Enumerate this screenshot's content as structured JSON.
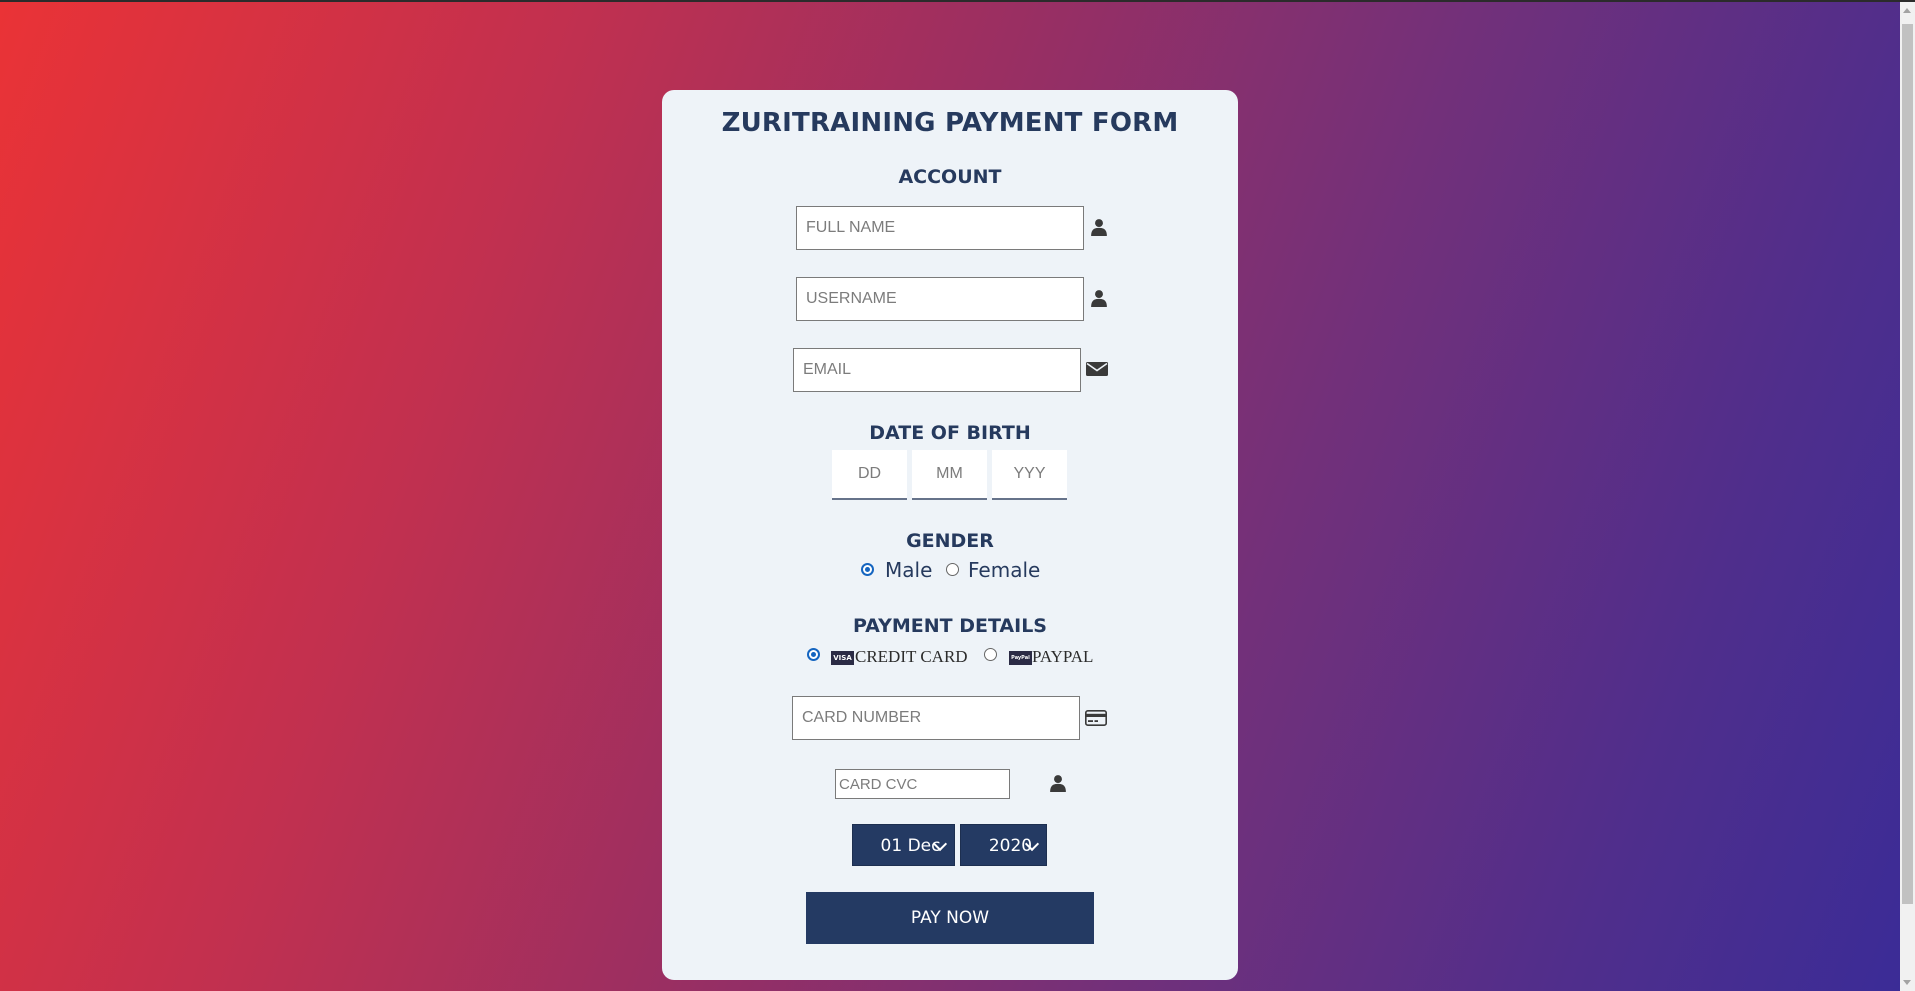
{
  "form": {
    "title": "ZURITRAINING PAYMENT FORM",
    "account_heading": "ACCOUNT",
    "full_name_placeholder": "FULL NAME",
    "username_placeholder": "USERNAME",
    "email_placeholder": "EMAIL",
    "dob_heading": "DATE OF BIRTH",
    "dob_day_placeholder": "DD",
    "dob_month_placeholder": "MM",
    "dob_year_placeholder": "YYY",
    "gender_heading": "GENDER",
    "gender_male": "Male",
    "gender_female": "Female",
    "gender_selected": "Male",
    "payment_heading": "PAYMENT DETAILS",
    "payment_credit_card": "CREDIT CARD",
    "payment_paypal": "PAYPAL",
    "payment_selected": "CREDIT CARD",
    "visa_logo": "VISA",
    "paypal_logo": "PayPal",
    "card_number_placeholder": "CARD NUMBER",
    "card_cvc_placeholder": "CARD CVC",
    "expiry_day_value": "01 Dec",
    "expiry_year_value": "2020",
    "pay_button": "PAY NOW"
  },
  "icons": {
    "full_name": "user-icon",
    "username": "user-icon",
    "email": "envelope-icon",
    "card_number": "credit-card-icon",
    "card_cvc": "user-icon",
    "select_arrow": "chevron-down-icon"
  },
  "colors": {
    "accent": "#263a5e",
    "button": "#243a63",
    "card_bg": "#eef3f8",
    "gradient_start": "#ea3336",
    "gradient_end": "#3a2c97"
  }
}
